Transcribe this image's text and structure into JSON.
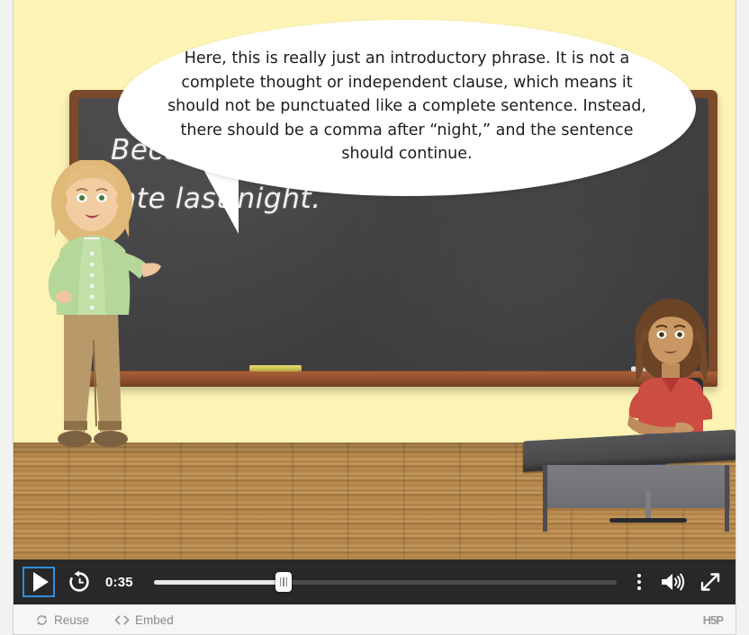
{
  "player": {
    "type": "h5p-interactive-video",
    "scene": {
      "setting": "classroom",
      "wall_color": "#fcf3b4",
      "floor_color": "#b58a50",
      "chalkboard_frame_color": "#7c4a2a",
      "chalkboard_surface_color": "#414143"
    },
    "speech_bubble": {
      "speaker": "teacher",
      "text": "Here, this is really just an introductory phrase. It is not a complete thought or independent clause, which means it should not be punctuated like a complete sentence. Instead, there should be a comma after “night,” and the sentence should continue."
    },
    "chalkboard": {
      "text": "Because I was so tired from working\nlate last night."
    },
    "characters": [
      {
        "name": "teacher",
        "description": "blonde teacher in light green cardigan and tan pants",
        "hair_color": "#e0b878",
        "top_color": "#b5d79a",
        "pants_color": "#b89a6a"
      },
      {
        "name": "student",
        "description": "student with curly brown hair in red top seated at desk",
        "hair_color": "#6b4426",
        "top_color": "#cc4d42",
        "pants_color": "#5d6e8e"
      }
    ]
  },
  "controls": {
    "play_label": "Play",
    "rewind_label": "Rewind 10 seconds",
    "current_time": "0:35",
    "seek_percent": 28,
    "overflow_label": "More options",
    "volume_label": "Mute",
    "fullscreen_label": "Fullscreen",
    "focus_color": "#2f8fe0",
    "bar_color": "#282828"
  },
  "footer": {
    "reuse_label": "Reuse",
    "embed_label": "Embed",
    "logo_label": "H5P"
  }
}
